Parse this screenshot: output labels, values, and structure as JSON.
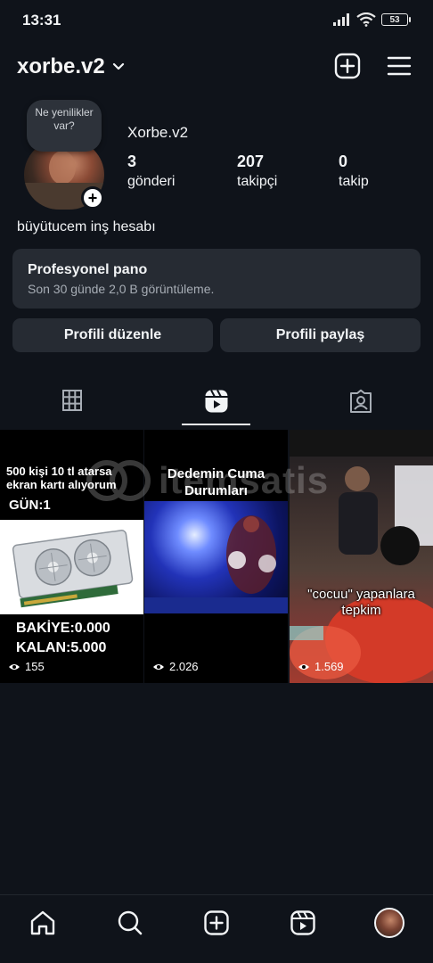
{
  "status_bar": {
    "time": "13:31",
    "battery": "53"
  },
  "header": {
    "username": "xorbe.v2",
    "icons": [
      "chevron-down-icon",
      "new-post-icon",
      "menu-icon"
    ]
  },
  "profile": {
    "note": "Ne yenilikler var?",
    "display_name": "Xorbe.v2",
    "stats": [
      {
        "value": "3",
        "label": "gönderi"
      },
      {
        "value": "207",
        "label": "takipçi"
      },
      {
        "value": "0",
        "label": "takip"
      }
    ],
    "bio": "büyütucem inş hesabı"
  },
  "professional_dashboard": {
    "title": "Profesyonel pano",
    "subtitle": "Son 30 günde 2,0 B görüntüleme."
  },
  "actions": {
    "edit_profile": "Profili düzenle",
    "share_profile": "Profili paylaş"
  },
  "tabs": [
    {
      "name": "posts",
      "icon": "grid-icon",
      "active": false
    },
    {
      "name": "reels",
      "icon": "reels-icon",
      "active": true
    },
    {
      "name": "tagged",
      "icon": "tagged-icon",
      "active": false
    }
  ],
  "reels": [
    {
      "line1": "500 kişi 10 tl atarsa",
      "line2": "ekran kartı alıyorum",
      "day": "GÜN:1",
      "balance": "BAKİYE:0.000",
      "remaining": "KALAN:5.000",
      "views": "155"
    },
    {
      "title_line1": "Dedemin Cuma",
      "title_line2": "Durumları",
      "views": "2.026"
    },
    {
      "caption_line1": "\"cocuu\" yapanlara",
      "caption_line2": "tepkim",
      "views": "1.569"
    }
  ],
  "watermark": "itemsatis",
  "bottom_nav": [
    "home-icon",
    "search-icon",
    "create-icon",
    "reels-icon",
    "profile-avatar"
  ]
}
